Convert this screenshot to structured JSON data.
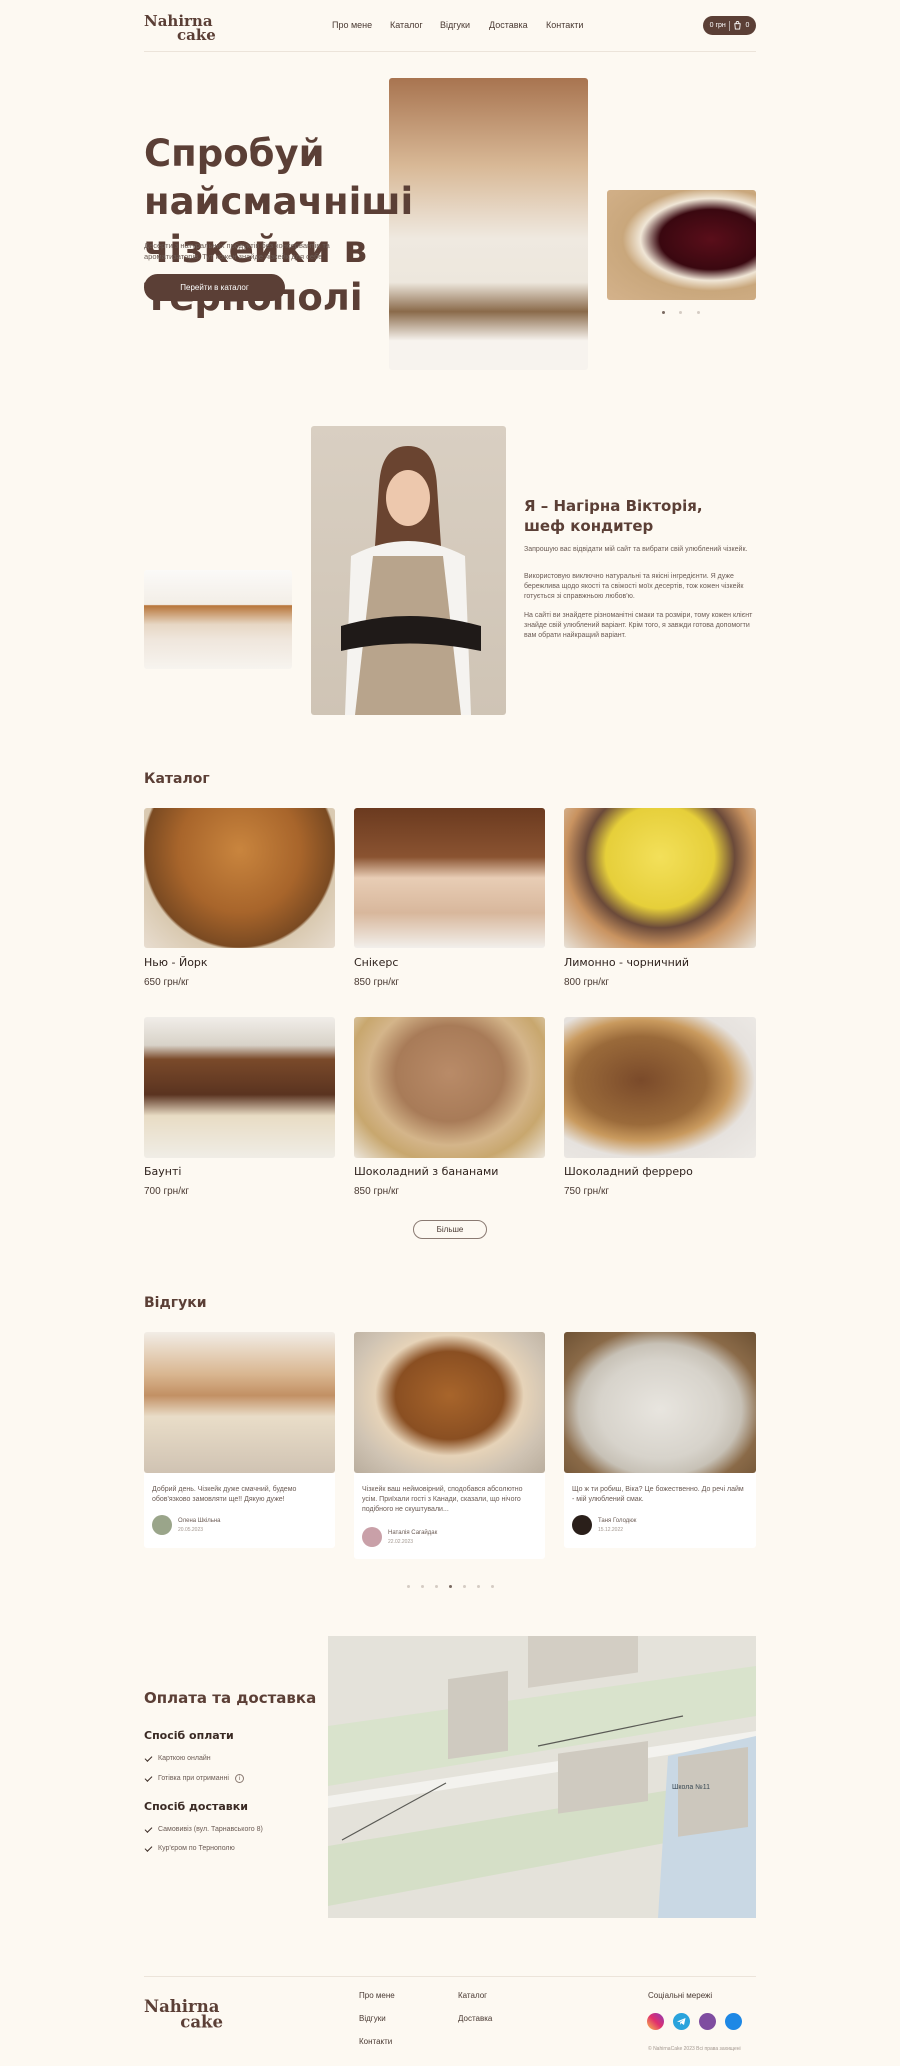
{
  "header": {
    "logo_line1": "Nahirna",
    "logo_line2": "cake",
    "nav": [
      "Про мене",
      "Каталог",
      "Відгуки",
      "Доставка",
      "Контакти"
    ],
    "cart_price": "0 грн",
    "cart_count": "0"
  },
  "hero": {
    "title": "Спробуй найсмачніші чізкейки в Тернополі",
    "subtitle": "Десерти з натуральних продуктів без консервантів та ароматизаторів. Тут кожен знайде чізкейк для себе",
    "cta": "Перейти в каталог"
  },
  "about": {
    "title": "Я – Нагірна Вікторія, шеф кондитер",
    "p1": "Запрошую вас відвідати мій сайт та вибрати свій улюблений чізкейк.",
    "p2": "Використовую виключно натуральні та якісні інгредієнти. Я дуже бережлива щодо якості та свіжості моїх десертів, тож кожен чізкейк готується зі справжньою любов'ю.",
    "p3": "На сайті ви знайдете різноманітні смаки та розміри, тому кожен клієнт знайде свій улюблений варіант. Крім того, я завжди готова допомогти вам обрати найкращий варіант."
  },
  "catalog": {
    "title": "Каталог",
    "items": [
      {
        "name": "Нью - Йорк",
        "price": "650 грн/кг"
      },
      {
        "name": "Снікерс",
        "price": "850 грн/кг"
      },
      {
        "name": "Лимонно - чорничний",
        "price": "800 грн/кг"
      },
      {
        "name": "Баунті",
        "price": "700 грн/кг"
      },
      {
        "name": "Шоколадний з бананами",
        "price": "850 грн/кг"
      },
      {
        "name": "Шоколадний ферреро",
        "price": "750 грн/кг"
      }
    ],
    "more": "Більше"
  },
  "reviews": {
    "title": "Відгуки",
    "items": [
      {
        "text": "Добрий день. Чізкейк дуже смачний, будемо обов'язково замовляти ще!! Дякую дуже!",
        "name": "Олена Шкільна",
        "date": "20.05.2023"
      },
      {
        "text": "Чізкейк ваш неймовірний, сподобався абсолютно усім. Приїхали гості з Канади, сказали, що нічого подібного не скуштували...",
        "name": "Наталія Сагайдак",
        "date": "22.02.2023"
      },
      {
        "text": "Що ж ти робиш, Віка? Це божественно. До речі лайм - мій улюблений смак.",
        "name": "Таня Голодюк",
        "date": "15.12.2022"
      }
    ]
  },
  "delivery": {
    "title": "Оплата та доставка",
    "pay_title": "Спосіб оплати",
    "pay": [
      "Карткою онлайн",
      "Готівка при отриманні"
    ],
    "ship_title": "Спосіб доставки",
    "ship": [
      "Самовивіз (вул. Тарнавського 8)",
      "Кур'єром по Тернополю"
    ],
    "map_school": "Школа №11"
  },
  "footer": {
    "links_col1": [
      "Про мене",
      "Відгуки",
      "Контакти"
    ],
    "links_col2": [
      "Каталог",
      "Доставка"
    ],
    "social_title": "Соціальні мережі",
    "copyright": "© NahirnaCake 2023 Всі права захищені",
    "social_icons": [
      "instagram-icon",
      "telegram-icon",
      "viber-icon",
      "messenger-icon"
    ]
  },
  "colors": {
    "accent": "#5b3f36",
    "background": "#fdf9f2"
  }
}
